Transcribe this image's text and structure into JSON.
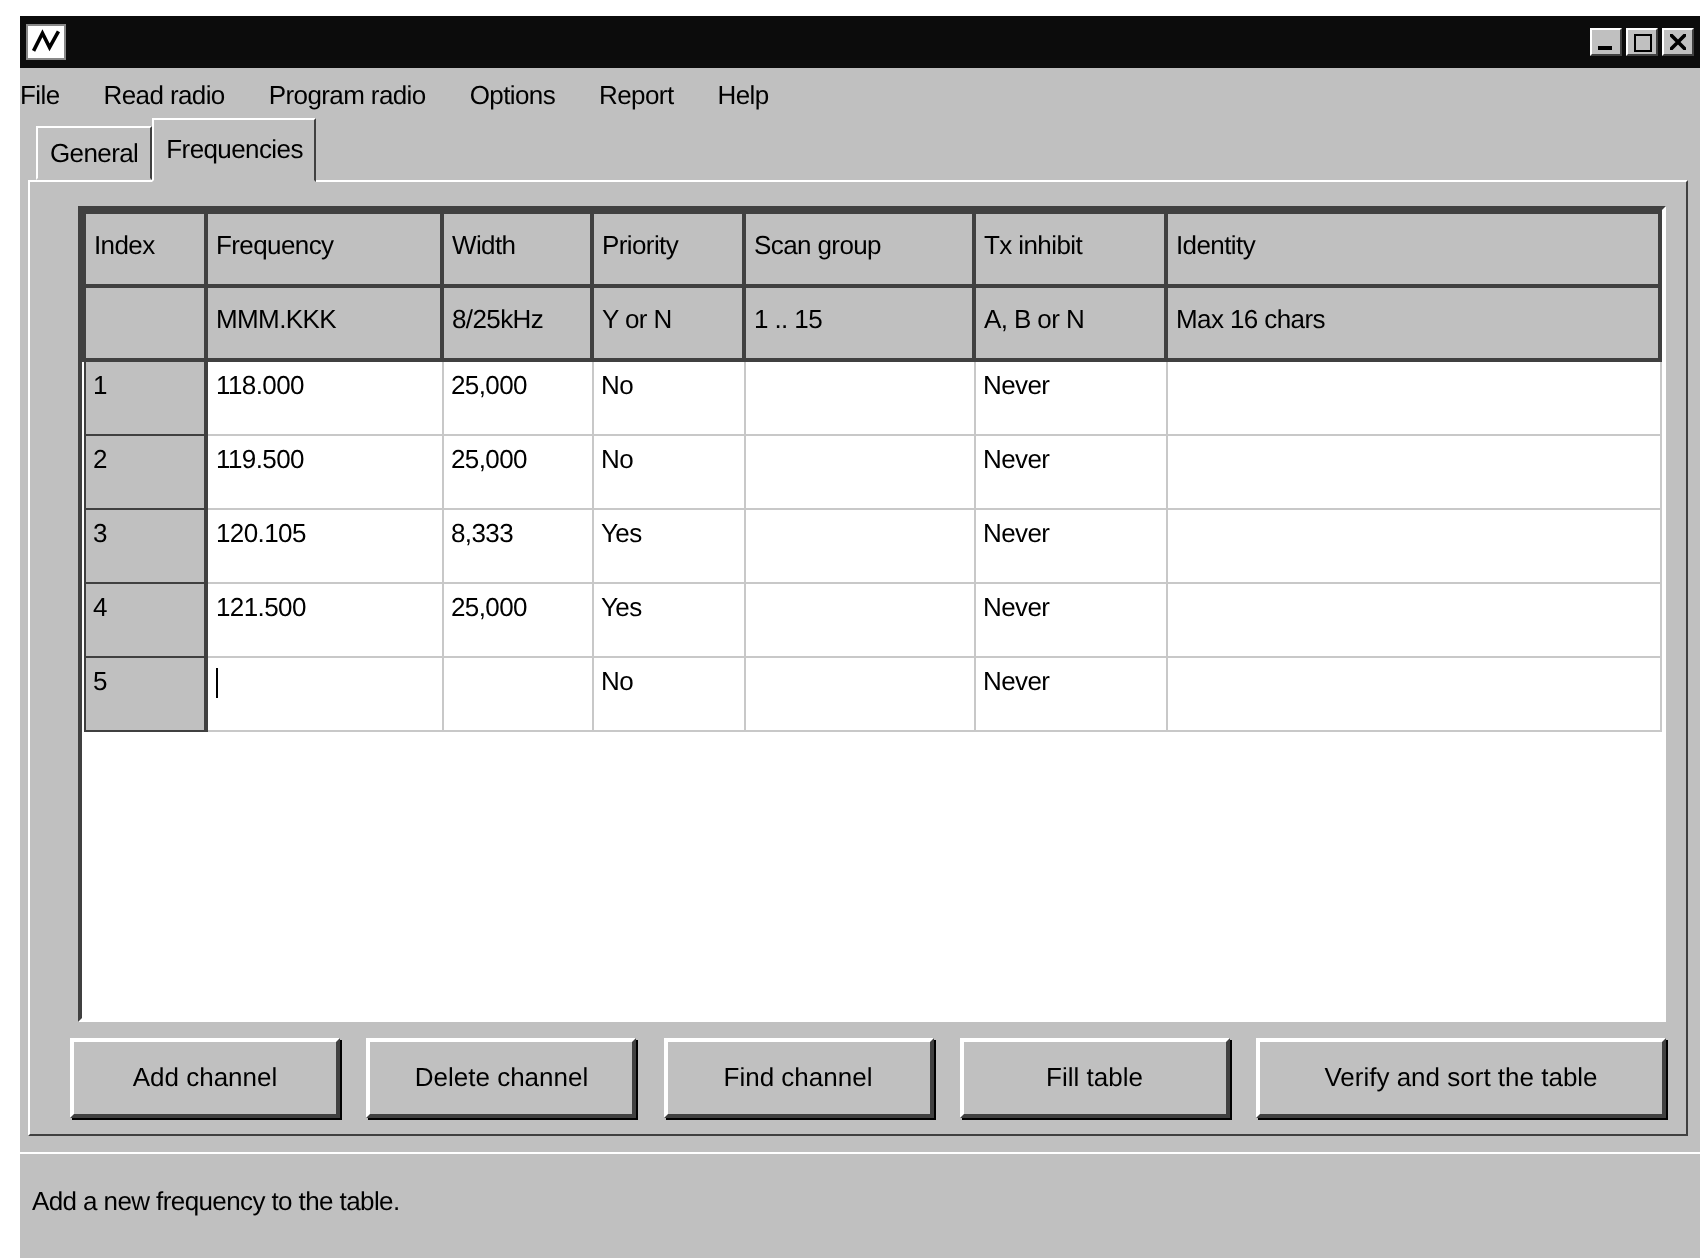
{
  "menu": [
    "File",
    "Read radio",
    "Program radio",
    "Options",
    "Report",
    "Help"
  ],
  "tabs": [
    {
      "label": "General",
      "selected": false
    },
    {
      "label": "Frequencies",
      "selected": true
    }
  ],
  "table": {
    "columns": [
      {
        "label": "Index"
      },
      {
        "label": "Frequency",
        "hint": "MMM.KKK"
      },
      {
        "label": "Width",
        "hint": "8/25kHz"
      },
      {
        "label": "Priority",
        "hint": "Y or N"
      },
      {
        "label": "Scan group",
        "hint": "1 .. 15"
      },
      {
        "label": "Tx inhibit",
        "hint": "A, B or N"
      },
      {
        "label": "Identity",
        "hint": "Max 16 chars"
      }
    ],
    "rows": [
      {
        "cells": [
          "1",
          "118.000",
          "25,000",
          "No",
          "",
          "Never",
          ""
        ],
        "editing": false
      },
      {
        "cells": [
          "2",
          "119.500",
          "25,000",
          "No",
          "",
          "Never",
          ""
        ],
        "editing": false
      },
      {
        "cells": [
          "3",
          "120.105",
          "8,333",
          "Yes",
          "",
          "Never",
          ""
        ],
        "editing": false
      },
      {
        "cells": [
          "4",
          "121.500",
          "25,000",
          "Yes",
          "",
          "Never",
          ""
        ],
        "editing": false
      },
      {
        "cells": [
          "5",
          "",
          "",
          "No",
          "",
          "Never",
          ""
        ],
        "editing": true
      }
    ]
  },
  "buttons": [
    "Add channel",
    "Delete channel",
    "Find channel",
    "Fill table",
    "Verify and sort the table"
  ],
  "status_bar": "Add a new frequency to the table."
}
